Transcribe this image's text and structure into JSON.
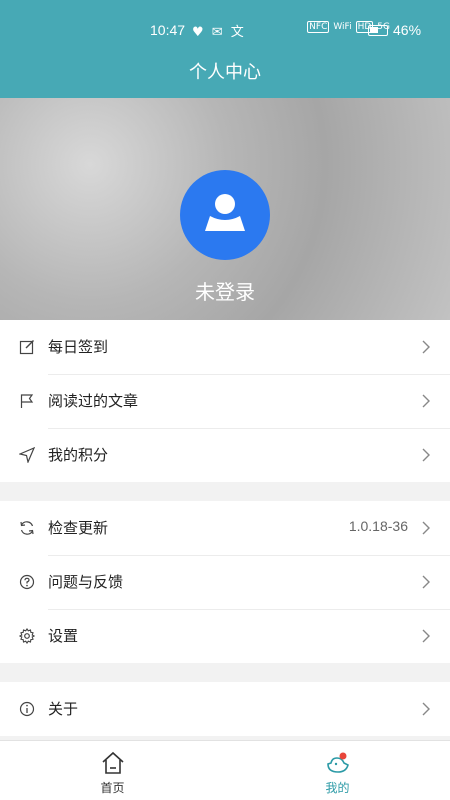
{
  "status_bar": {
    "time": "10:47",
    "notif_icons": "♥ ✉ 文",
    "network_icons": [
      "NFC",
      "WiFi",
      "HD",
      "5G"
    ],
    "battery": "46%"
  },
  "header": {
    "title": "个人中心"
  },
  "profile": {
    "login_text": "未登录"
  },
  "menu_group_1": [
    {
      "label": "每日签到",
      "icon": "edit-icon"
    },
    {
      "label": "阅读过的文章",
      "icon": "flag-icon"
    },
    {
      "label": "我的积分",
      "icon": "send-icon"
    }
  ],
  "menu_group_2": [
    {
      "label": "检查更新",
      "icon": "refresh-icon",
      "value": "1.0.18-36"
    },
    {
      "label": "问题与反馈",
      "icon": "question-icon"
    },
    {
      "label": "设置",
      "icon": "gear-icon"
    }
  ],
  "menu_group_3": [
    {
      "label": "关于",
      "icon": "info-icon"
    }
  ],
  "bottom_nav": {
    "home_label": "首页",
    "mine_label": "我的",
    "active": "mine"
  },
  "colors": {
    "header": "#47a9b5",
    "avatar": "#2b79f0",
    "active_tab": "#2b9aa6"
  }
}
